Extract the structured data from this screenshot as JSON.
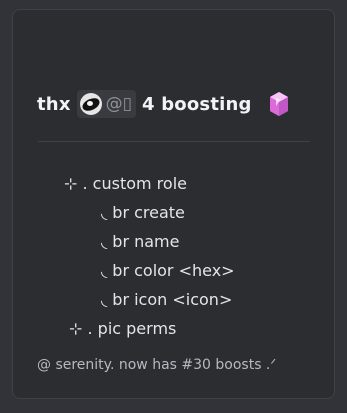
{
  "title": {
    "prefix": "thx",
    "mention": "@",
    "mention_glyph": "▯",
    "suffix": "4 boosting",
    "gem_icon": "pink-crystal-icon",
    "gem_color": "#e784e8"
  },
  "list": {
    "custom_role": "⊹ . custom role",
    "sub_items": [
      "◟ br create",
      "◟ br name",
      "◟ br color <hex>",
      "◟ br icon <icon>"
    ],
    "pic_perms": "⊹ . pic perms"
  },
  "footer": "@ serenity. now has #30 boosts  .ᐟ"
}
